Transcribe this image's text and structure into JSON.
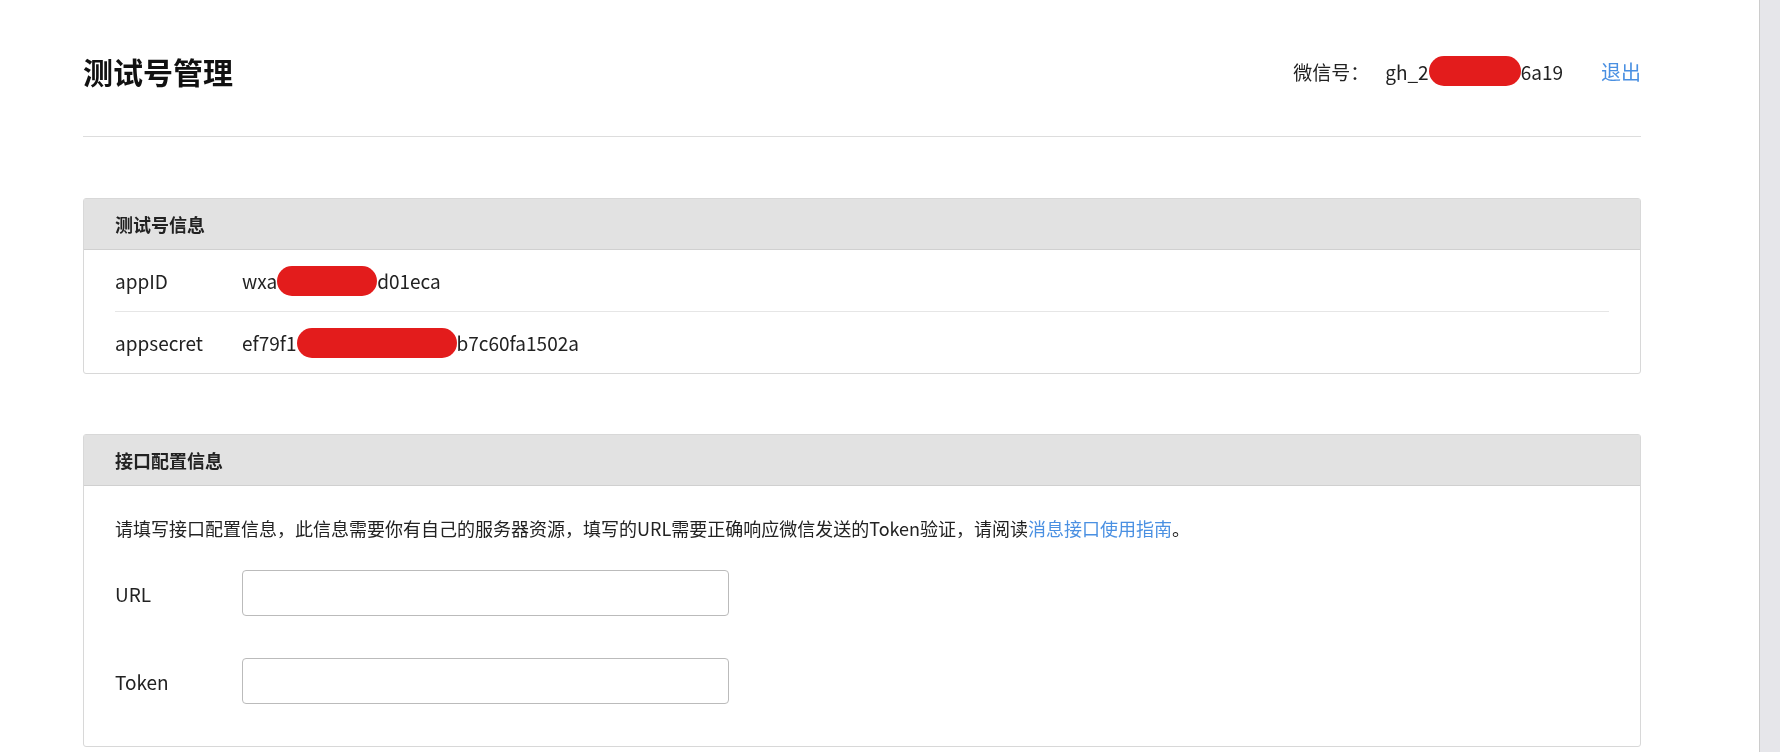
{
  "header": {
    "title": "测试号管理",
    "account_label": "微信号：",
    "account_prefix": "gh_2",
    "account_suffix": "6a19",
    "logout": "退出"
  },
  "info_panel": {
    "title": "测试号信息",
    "rows": [
      {
        "label": "appID",
        "prefix": "wxa",
        "suffix": "d01eca"
      },
      {
        "label": "appsecret",
        "prefix": "ef79f1",
        "suffix": "b7c60fa1502a"
      }
    ]
  },
  "config_panel": {
    "title": "接口配置信息",
    "intro": "请填写接口配置信息，此信息需要你有自己的服务器资源，填写的URL需要正确响应微信发送的Token验证，请阅读",
    "intro_link": "消息接口使用指南",
    "intro_end": "。",
    "fields": [
      {
        "label": "URL"
      },
      {
        "label": "Token"
      }
    ]
  }
}
